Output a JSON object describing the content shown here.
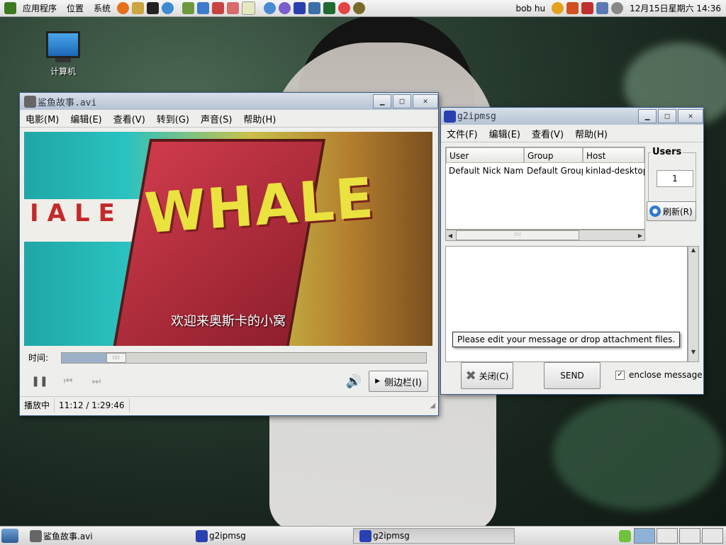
{
  "top_panel": {
    "menus": [
      "应用程序",
      "位置",
      "系统"
    ],
    "username": "bob hu",
    "clock": "12月15日星期六 14:36"
  },
  "desktop": {
    "icon_label": "计算机"
  },
  "player": {
    "title": "鲨鱼故事.avi",
    "menus": [
      "电影(M)",
      "编辑(E)",
      "查看(V)",
      "转到(G)",
      "声音(S)",
      "帮助(H)"
    ],
    "subtitle": "欢迎来奥斯卡的小窝",
    "video_text_whale": "WHALE",
    "video_text_sign": "IALE",
    "time_label": "时间:",
    "progress": 0.149,
    "sidebar_label": "侧边栏(I)",
    "status_state": "播放中",
    "status_time": "11:12 / 1:29:46"
  },
  "ipmsg": {
    "title": "g2ipmsg",
    "menus": [
      "文件(F)",
      "编辑(E)",
      "查看(V)",
      "帮助(H)"
    ],
    "columns": [
      "User",
      "Group",
      "Host"
    ],
    "rows": [
      [
        "Default Nick Name",
        "Default Group",
        "kinlad-desktop"
      ]
    ],
    "users_label": "Users",
    "users_count": "1",
    "refresh_label": "刷新(R)",
    "tooltip": "Please edit your message or drop attachment files.",
    "close_label": "关闭(C)",
    "send_label": "SEND",
    "enclose_label": "enclose message",
    "enclose_checked": "✓"
  },
  "bottom_panel": {
    "tasks": [
      "鲨鱼故事.avi",
      "g2ipmsg",
      "g2ipmsg"
    ]
  },
  "colors": {
    "titlebar": "#b4c2d4",
    "accent": "#3a5d8a"
  }
}
